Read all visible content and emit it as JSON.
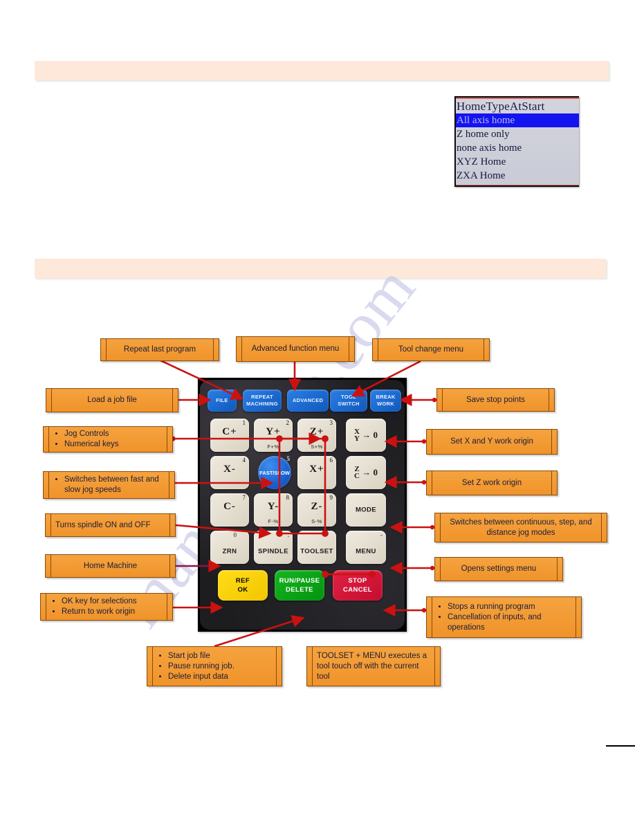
{
  "page": {
    "banner_top_text": "",
    "banner_middle_text": "",
    "watermark": "manualsave.com"
  },
  "lcd": {
    "title": "HomeTypeAtStart",
    "options": [
      {
        "label": "All axis home",
        "selected": true
      },
      {
        "label": "Z home only",
        "selected": false
      },
      {
        "label": "none axis home",
        "selected": false
      },
      {
        "label": "XYZ Home",
        "selected": false
      },
      {
        "label": "ZXA Home",
        "selected": false
      }
    ]
  },
  "keypad": {
    "function_keys": [
      {
        "name": "file",
        "lines": [
          "FILE"
        ]
      },
      {
        "name": "repeat",
        "lines": [
          "REPEAT",
          "MACHINING"
        ]
      },
      {
        "name": "advanced",
        "lines": [
          "ADVANCED"
        ]
      },
      {
        "name": "tool-switch",
        "lines": [
          "TOOL",
          "SWITCH"
        ]
      },
      {
        "name": "break-work",
        "lines": [
          "BREAK",
          "WORK"
        ]
      }
    ],
    "num_keys": [
      {
        "name": "c-plus",
        "digit": "1",
        "main": "C+",
        "sub": ""
      },
      {
        "name": "y-plus",
        "digit": "2",
        "main": "Y+",
        "sub": "F+%"
      },
      {
        "name": "z-plus",
        "digit": "3",
        "main": "Z+",
        "sub": "S+%"
      },
      {
        "name": "x-minus",
        "digit": "4",
        "main": "X-",
        "sub": ""
      },
      {
        "name": "x-plus",
        "digit": "6",
        "main": "X+",
        "sub": ""
      },
      {
        "name": "c-minus",
        "digit": "7",
        "main": "C-",
        "sub": ""
      },
      {
        "name": "y-minus",
        "digit": "8",
        "main": "Y-",
        "sub": "F-%"
      },
      {
        "name": "z-minus",
        "digit": "9",
        "main": "Z-",
        "sub": "S-%"
      }
    ],
    "fast_slow": {
      "digit": "5",
      "label": "FAST/SLOW"
    },
    "origin_keys": [
      {
        "name": "xy-zero",
        "top": "X",
        "bottom": "Y",
        "arrow": "→ 0"
      },
      {
        "name": "zc-zero",
        "top": "Z",
        "bottom": "C",
        "arrow": "→ 0"
      }
    ],
    "word_keys": [
      {
        "name": "mode",
        "label": "MODE",
        "alt": ""
      },
      {
        "name": "zrn",
        "label": "ZRN",
        "alt": "0"
      },
      {
        "name": "spindle",
        "label": "SPINDLE",
        "alt": "."
      },
      {
        "name": "toolset",
        "label": "TOOLSET",
        "alt": ""
      },
      {
        "name": "menu",
        "label": "MENU",
        "alt": "-"
      }
    ],
    "action_keys": [
      {
        "name": "ref-ok",
        "line1": "REF",
        "line2": "OK",
        "color": "#ffd400"
      },
      {
        "name": "run-pause",
        "line1": "RUN/PAUSE",
        "line2": "DELETE",
        "color": "#04930f"
      },
      {
        "name": "stop-cancel",
        "line1": "STOP",
        "line2": "CANCEL",
        "color": "#c40d31"
      }
    ]
  },
  "callouts": {
    "repeat_last_program": "Repeat last program",
    "advanced_function_menu": "Advanced function menu",
    "tool_change_menu": "Tool change menu",
    "load_a_job_file": "Load a job file",
    "save_stop_points": "Save stop points",
    "jog_controls": [
      "Jog Controls",
      "Numerical keys"
    ],
    "set_xy_work_origin": "Set X and Y work origin",
    "fast_slow_jog": [
      "Switches between fast and slow jog speeds"
    ],
    "set_z_work_origin": "Set Z work origin",
    "spindle_on_off": "Turns spindle ON and OFF",
    "jog_modes": "Switches between continuous, step, and distance jog modes",
    "home_machine": "Home Machine",
    "opens_settings_menu": "Opens settings menu",
    "ok_key": [
      "OK key for selections",
      "Return to work origin"
    ],
    "stop_program": [
      "Stops a running program",
      "Cancellation of inputs, and operations"
    ],
    "run_pause_delete": [
      "Start job file",
      "Pause running job.",
      "Delete input data"
    ],
    "toolset_menu_combo": "TOOLSET + MENU executes a tool touch off with the current tool"
  },
  "colors": {
    "callout_fill": "#f5a33f",
    "callout_border": "#8a4a0a",
    "banner": "#fde8da",
    "arrow": "#cc1111",
    "function_key": "#1f6fd6",
    "lcd_highlight": "#1414f0"
  }
}
